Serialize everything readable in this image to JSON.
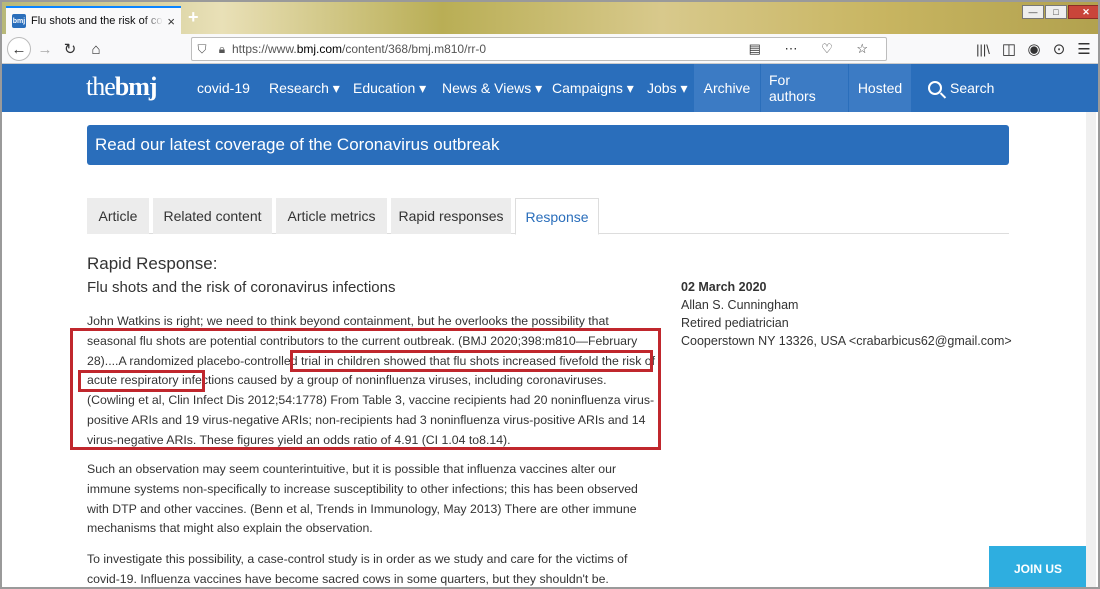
{
  "browser": {
    "tab_title": "Flu shots and the risk of corona",
    "favicon_text": "bmj",
    "tab_close": "×",
    "new_tab": "+",
    "url_prefix": "https://www.",
    "url_host": "bmj.com",
    "url_path": "/content/368/bmj.m810/rr-0",
    "controls": {
      "minimize": "—",
      "maximize": "□",
      "close": "✕"
    }
  },
  "site": {
    "logo_light": "the",
    "logo_bold": "bmj",
    "nav": [
      {
        "label": "covid-19"
      },
      {
        "label": "Research ▾"
      },
      {
        "label": "Education ▾"
      },
      {
        "label": "News & Views ▾"
      },
      {
        "label": "Campaigns ▾"
      },
      {
        "label": "Jobs ▾"
      },
      {
        "label": "Archive"
      },
      {
        "label": "For authors"
      },
      {
        "label": "Hosted"
      }
    ],
    "search_label": "Search"
  },
  "banner": "Read our latest coverage of the Coronavirus outbreak",
  "tabs": [
    "Article",
    "Related content",
    "Article metrics",
    "Rapid responses",
    "Response"
  ],
  "active_tab": "Response",
  "response": {
    "heading": "Rapid Response:",
    "title": "Flu shots and the risk of coronavirus infections",
    "paragraphs": [
      "John Watkins is right; we need to think beyond containment, but he overlooks the possibility that seasonal flu shots are potential contributors to the current outbreak. (BMJ 2020;398:m810—February 28)....A randomized placebo-controlled trial in children showed that flu shots increased fivefold the risk of acute respiratory infections caused by a group of noninfluenza viruses, including coronaviruses. (Cowling et al, Clin Infect Dis 2012;54:1778) From Table 3, vaccine recipients had 20 noninfluenza virus-positive ARIs and 19 virus-negative ARIs; non-recipients had 3 noninfluenza virus-positive ARIs and 14 virus-negative ARIs. These figures yield an odds ratio of 4.91 (CI 1.04 to8.14).",
      "Such an observation may seem counterintuitive, but it is possible that influenza vaccines alter our immune systems non-specifically to increase susceptibility to other infections; this has been observed with DTP and other vaccines. (Benn et al, Trends in Immunology, May 2013) There are other immune mechanisms that might also explain the observation.",
      "To investigate this possibility, a case-control study is in order as we study and care for the victims of covid-19. Influenza vaccines have become sacred cows in some quarters, but they shouldn't be."
    ]
  },
  "author": {
    "date": "02 March 2020",
    "name": "Allan S. Cunningham",
    "role": "Retired pediatrician",
    "address": "Cooperstown NY 13326, USA <crabarbicus62@gmail.com>"
  },
  "join_us": "JOIN US",
  "colors": {
    "brand": "#2a6ebb",
    "highlight": "#c0272d",
    "join": "#2eaee0"
  }
}
